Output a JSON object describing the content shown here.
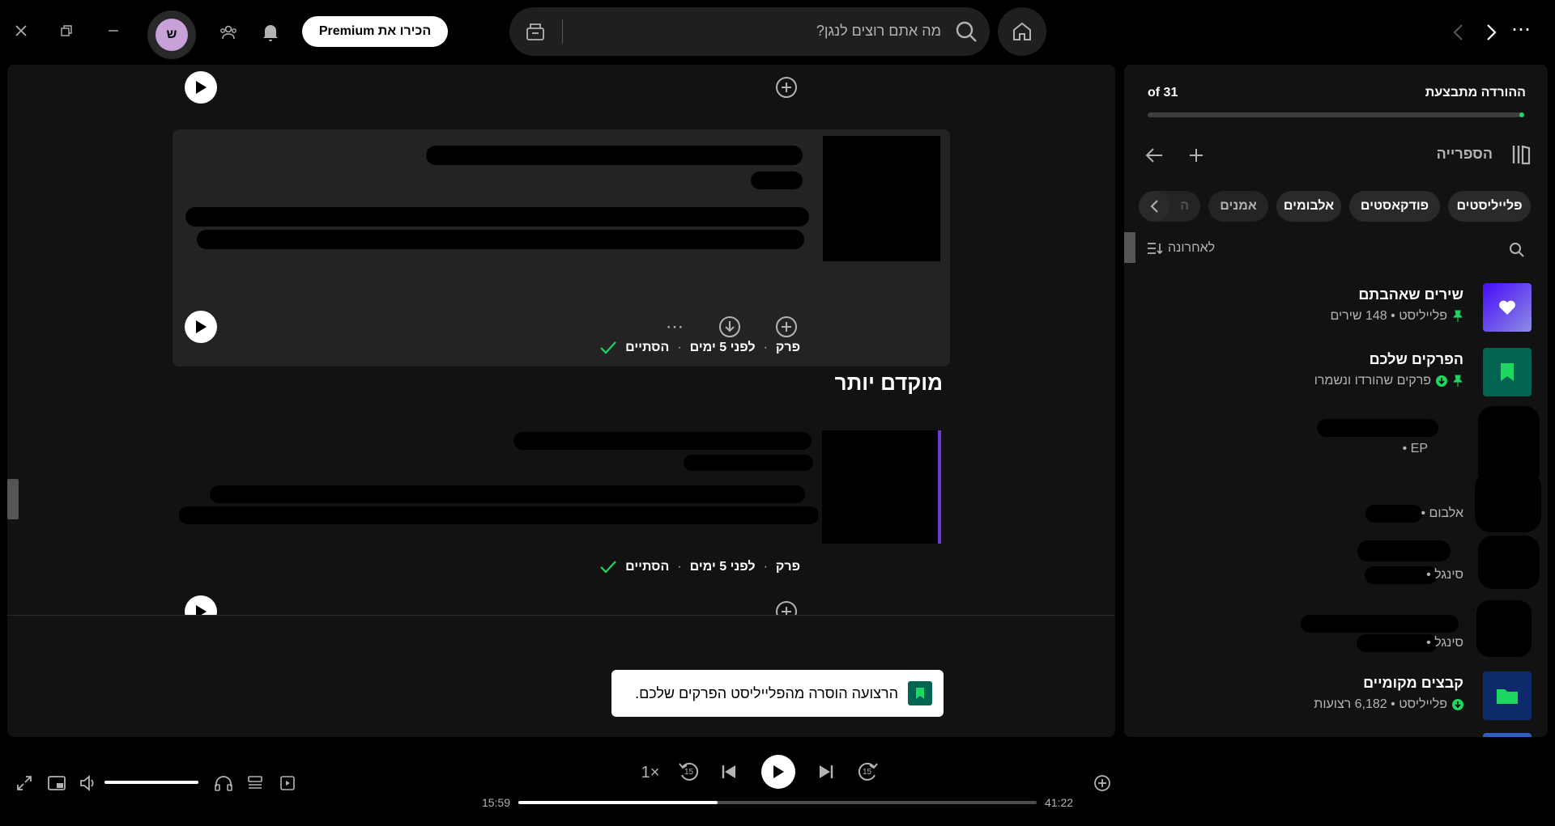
{
  "window": {
    "close_label": "×"
  },
  "header": {
    "premium_label": "הכירו את Premium",
    "avatar_letter": "ש",
    "search_placeholder": "מה אתם רוצים לנגן?",
    "more_label": "⋯"
  },
  "main": {
    "episode1": {
      "type": "פרק",
      "age": "לפני 5 ימים",
      "status": "הסתיים"
    },
    "section_title": "מוקדם יותר",
    "episode2": {
      "type": "פרק",
      "age": "לפני 5 ימים",
      "status": "הסתיים"
    },
    "toast": "הרצועה הוסרה מהפלייליסט הפרקים שלכם."
  },
  "sidebar": {
    "download_status": "ההורדה מתבצעת",
    "download_count": "of 31",
    "download_progress": 0.97,
    "library_title": "הספרייה",
    "filters": [
      "פלייליסטים",
      "פודקאסטים",
      "אלבומים",
      "אמנים",
      "ה"
    ],
    "sort_label": "לאחרונה",
    "items": [
      {
        "title": "שירים שאהבתם",
        "subtitle": "פלייליסט • 148 שירים"
      },
      {
        "title": "הפרקים שלכם",
        "subtitle": "פרקים שהורדו ונשמרו"
      },
      {
        "title": "",
        "subtitle": "EP •"
      },
      {
        "title": "",
        "subtitle": "אלבום •"
      },
      {
        "title": "",
        "subtitle": "סינגל •"
      },
      {
        "title": "",
        "subtitle": "סינגל •"
      },
      {
        "title": "קבצים מקומיים",
        "subtitle": "פלייליסט • 6,182 רצועות"
      }
    ]
  },
  "player": {
    "speed": "1×",
    "skip_back": "15",
    "skip_fwd": "15",
    "elapsed": "15:59",
    "total": "41:22",
    "progress": 0.385,
    "volume": 1.0
  },
  "colors": {
    "accent": "#1ed760",
    "bg": "#000000",
    "panel": "#121212",
    "card": "#202020"
  }
}
